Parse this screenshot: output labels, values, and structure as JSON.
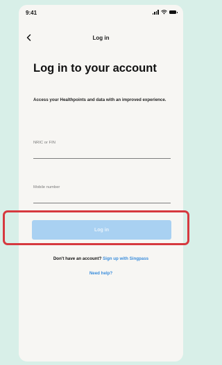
{
  "status_bar": {
    "time": "9:41"
  },
  "nav": {
    "title": "Log in"
  },
  "main": {
    "title": "Log in to your account",
    "subtitle": "Access your Healthpoints and data with an improved experience.",
    "fields": {
      "nric": {
        "label": "NRIC or FIN",
        "value": ""
      },
      "mobile": {
        "label": "Mobile number",
        "value": ""
      }
    },
    "login_button_label": "Log in",
    "signup_prompt": "Don't have an account?",
    "signup_link": "Sign up with Singpass",
    "help_link": "Need help?"
  },
  "colors": {
    "background": "#d8efe8",
    "screen": "#f7f6f3",
    "primary_disabled": "#a9d1f2",
    "link": "#3a8ddc",
    "highlight": "#d6393f"
  },
  "icons": {
    "back": "chevron-left-icon",
    "signal": "signal-icon",
    "wifi": "wifi-icon",
    "battery": "battery-icon"
  }
}
